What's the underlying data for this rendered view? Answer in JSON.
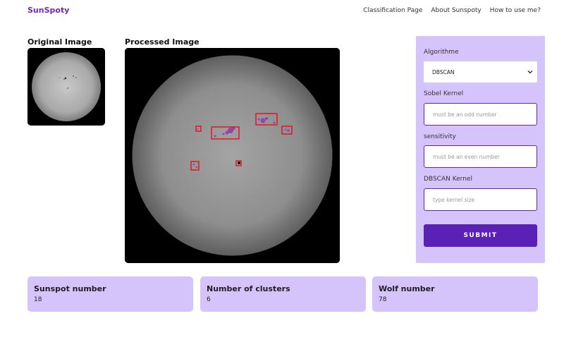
{
  "app": {
    "brand": "SunSpoty"
  },
  "nav": {
    "items": [
      {
        "label": "Classification Page"
      },
      {
        "label": "About Sunspoty"
      },
      {
        "label": "How to use me?"
      }
    ]
  },
  "images": {
    "original_title": "Original Image",
    "processed_title": "Processed Image"
  },
  "form": {
    "algorithm_label": "Algorithme",
    "algorithm_value": "DBSCAN",
    "sobel_label": "Sobel Kernel",
    "sobel_placeholder": "must be an odd number",
    "sensitivity_label": "sensitivity",
    "sensitivity_placeholder": "must be an even number",
    "dbscan_label": "DBSCAN Kernel",
    "dbscan_placeholder": "type kernel size",
    "submit_label": "SUBMIT"
  },
  "stats": [
    {
      "title": "Sunspot number",
      "value": "18"
    },
    {
      "title": "Number of clusters",
      "value": "6"
    },
    {
      "title": "Wolf number",
      "value": "78"
    }
  ],
  "colors": {
    "accent": "#5b20b5",
    "panel": "#d5c4fb",
    "brand": "#6a2bb3",
    "detection_box": "#e01020"
  }
}
